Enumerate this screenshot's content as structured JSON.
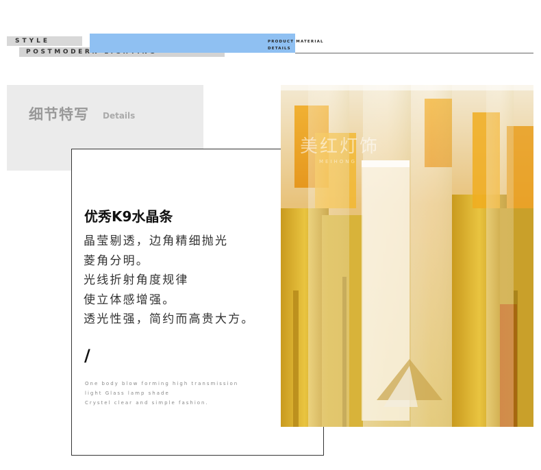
{
  "header": {
    "style_label": "STYLE",
    "subtitle": "POSTMODERN LIGHTING",
    "product_line1": "PRODUCT MATERIAL",
    "product_line2": "DETAILS",
    "accent_color": "#8fc0f2"
  },
  "section": {
    "title_cn": "细节特写",
    "title_en": "Details"
  },
  "feature": {
    "heading": "优秀K9水晶条",
    "lines": [
      "晶莹剔透，边角精细抛光",
      "菱角分明。",
      "光线折射角度规律",
      "使立体感增强。",
      "透光性强，简约而高贵大方。"
    ],
    "slash": "/",
    "en_lines": [
      "One body blow forming high transmission",
      "light Glass lamp shade",
      "Crystel clear and simple fashion."
    ]
  },
  "photo": {
    "watermark_cn": "美红灯饰",
    "watermark_en": "MEIHONG"
  }
}
